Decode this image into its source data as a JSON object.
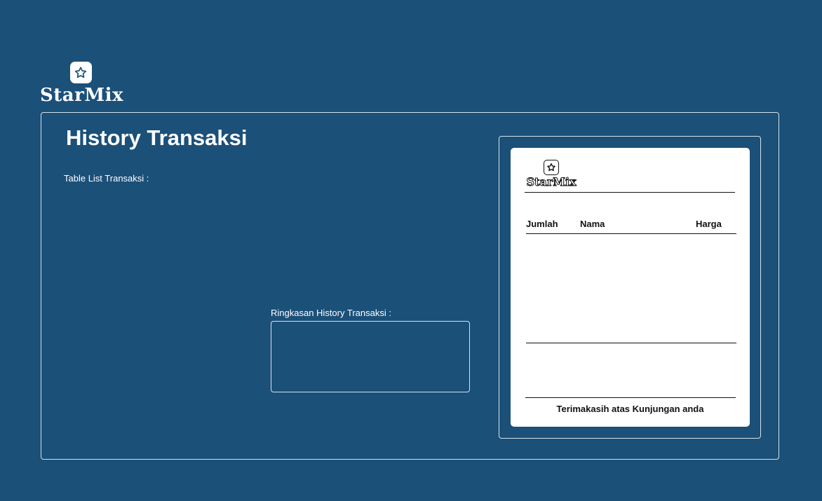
{
  "brand": {
    "name": "StarMix",
    "icon": "star-icon"
  },
  "page": {
    "title": "History Transaksi",
    "table_label": "Table List Transaksi :",
    "summary_label": "Ringkasan History Transaksi :"
  },
  "receipt": {
    "brand_name": "StarMix",
    "columns": [
      "Jumlah",
      "Nama",
      "Harga"
    ],
    "footer": "Terimakasih atas Kunjungan anda"
  },
  "colors": {
    "background": "#1b5079",
    "panel_border": "#d8e2ea",
    "receipt_bg": "#ffffff",
    "text_light": "#ffffff",
    "text_dark": "#111111"
  }
}
